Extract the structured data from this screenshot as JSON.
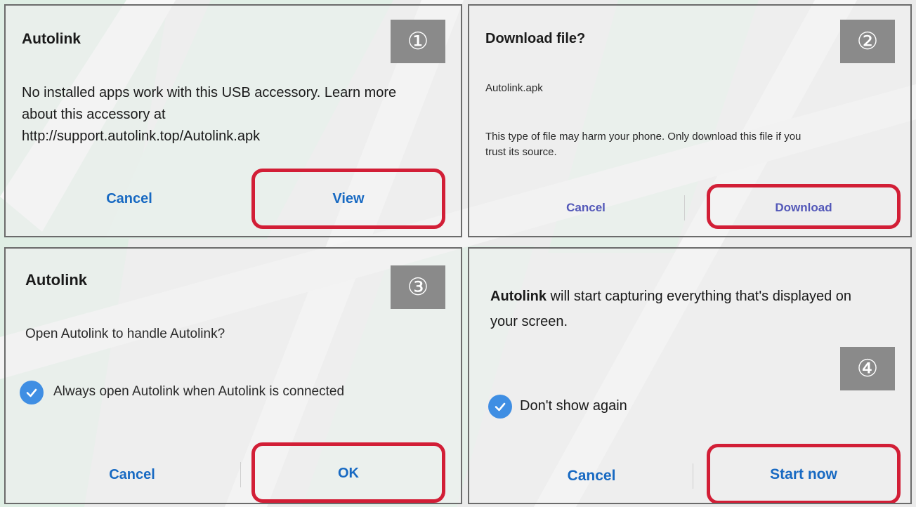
{
  "dialog1": {
    "step": "①",
    "title": "Autolink",
    "message_lines": [
      "No installed apps work with this USB accessory. Learn more",
      "about this accessory at",
      "http://support.autolink.top/Autolink.apk"
    ],
    "cancel_label": "Cancel",
    "confirm_label": "View"
  },
  "dialog2": {
    "step": "②",
    "title": "Download file?",
    "filename": "Autolink.apk",
    "warning_lines": [
      "This type of file may harm your phone. Only download this file if you",
      "trust its source."
    ],
    "cancel_label": "Cancel",
    "confirm_label": "Download"
  },
  "dialog3": {
    "step": "③",
    "title": "Autolink",
    "message": "Open Autolink to handle Autolink?",
    "checkbox_label": "Always open Autolink when Autolink is connected",
    "cancel_label": "Cancel",
    "confirm_label": "OK"
  },
  "dialog4": {
    "step": "④",
    "message_bold": "Autolink",
    "message_rest": " will start capturing everything that's displayed on",
    "message_line2": "your screen.",
    "checkbox_label": "Don't show again",
    "cancel_label": "Cancel",
    "confirm_label": "Start now"
  },
  "colors": {
    "highlight": "#d21e36",
    "button_blue": "#1769c2",
    "button_purple": "#5257b8",
    "checkbox": "#3f8ee3",
    "badge": "#8a8a8a"
  }
}
